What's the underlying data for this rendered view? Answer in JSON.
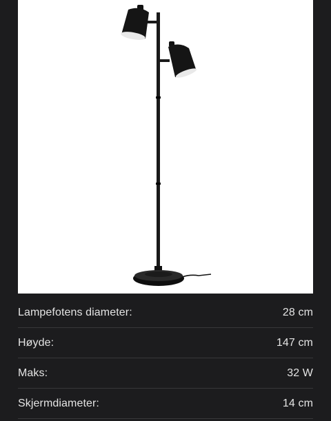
{
  "product": {
    "image_alt": "floor-lamp-with-two-spotlights"
  },
  "specs": [
    {
      "label": "Lampefotens diameter:",
      "value": "28 cm"
    },
    {
      "label": "Høyde:",
      "value": "147 cm"
    },
    {
      "label": "Maks:",
      "value": "32 W"
    },
    {
      "label": "Skjermdiameter:",
      "value": "14 cm"
    }
  ],
  "colors": {
    "background": "#1c1c1e",
    "image_bg": "#ffffff",
    "text": "#e4e4e4",
    "divider": "#38383a",
    "lamp": "#1a1a1a"
  }
}
